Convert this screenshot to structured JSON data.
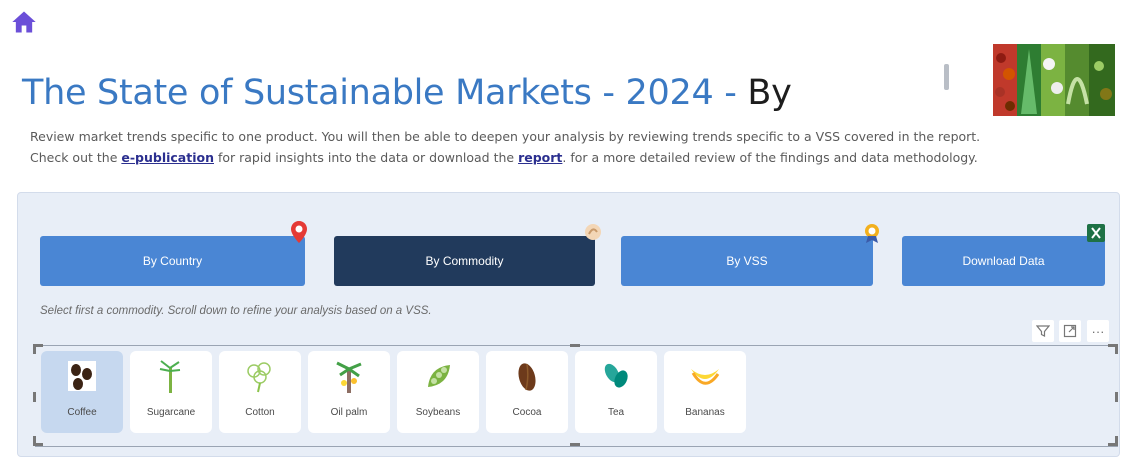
{
  "header": {
    "home_icon": "home-icon",
    "title_main": "The State of Sustainable Markets - 2024 - ",
    "title_suffix": "By"
  },
  "description": {
    "line1": "Review market trends specific to one product. You will then be able to deepen your analysis by reviewing trends specific to a VSS covered in the report.",
    "line2_before": "Check out the ",
    "epub_link": "e-publication",
    "line2_middle": " for rapid insights into the data or download the ",
    "report_link": "report",
    "line2_after": ". for a more detailed review of the findings and data methodology."
  },
  "nav": {
    "country": "By Country",
    "commodity": "By Commodity",
    "vss": "By VSS",
    "download": "Download Data",
    "active": "By Commodity"
  },
  "hint": "Select first a commodity. Scroll down to refine your analysis based on a VSS.",
  "toolbar": {
    "filter_icon": "filter-icon",
    "focus_icon": "focus-mode-icon",
    "more": "···"
  },
  "commodities": [
    {
      "label": "Coffee",
      "icon": "coffee-icon",
      "selected": true
    },
    {
      "label": "Sugarcane",
      "icon": "sugarcane-icon",
      "selected": false
    },
    {
      "label": "Cotton",
      "icon": "cotton-icon",
      "selected": false
    },
    {
      "label": "Oil palm",
      "icon": "oil-palm-icon",
      "selected": false
    },
    {
      "label": "Soybeans",
      "icon": "soybeans-icon",
      "selected": false
    },
    {
      "label": "Cocoa",
      "icon": "cocoa-icon",
      "selected": false
    },
    {
      "label": "Tea",
      "icon": "tea-icon",
      "selected": false
    },
    {
      "label": "Bananas",
      "icon": "bananas-icon",
      "selected": false
    }
  ],
  "colors": {
    "title_blue": "#3a79c3",
    "button_blue": "#4a86d4",
    "button_active": "#213a5c",
    "panel_bg": "#e8eef7",
    "selected_tile": "#c6d8ef"
  }
}
